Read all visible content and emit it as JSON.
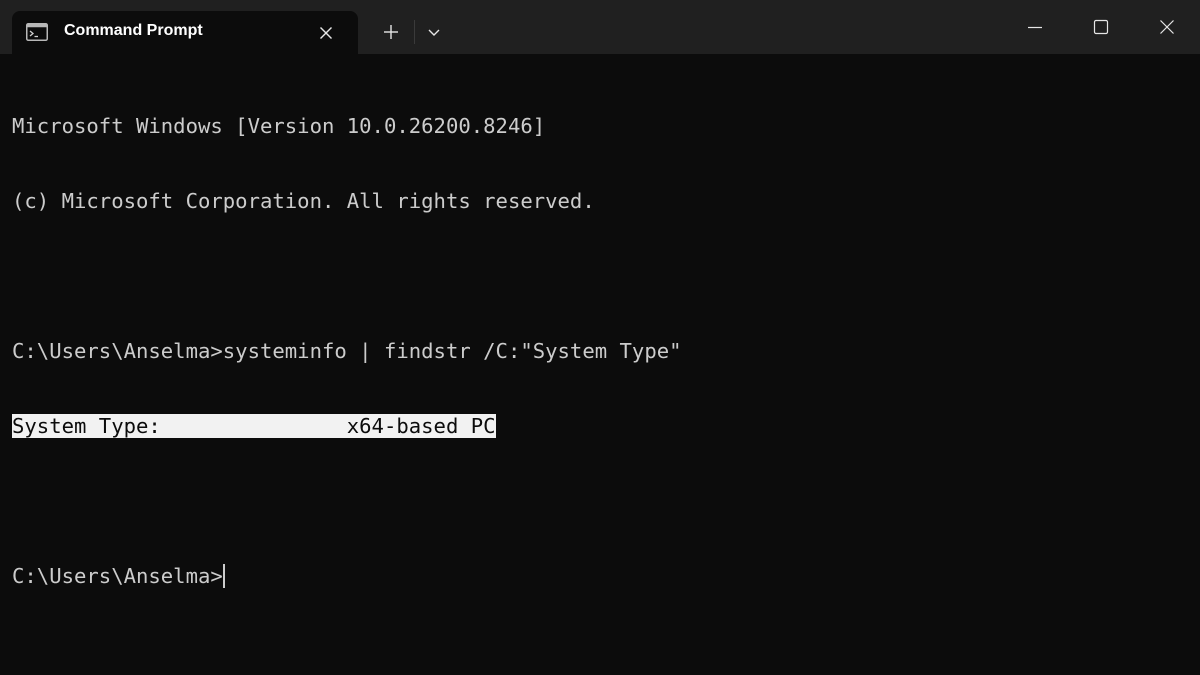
{
  "tab": {
    "title": "Command Prompt",
    "icon": "terminal-icon"
  },
  "tabbar": {
    "new_tab_icon": "plus-icon",
    "dropdown_icon": "chevron-down-icon"
  },
  "window_controls": {
    "minimize_icon": "minimize-icon",
    "maximize_icon": "maximize-icon",
    "close_icon": "close-icon"
  },
  "terminal": {
    "lines": [
      "Microsoft Windows [Version 10.0.26200.8246]",
      "(c) Microsoft Corporation. All rights reserved.",
      "",
      "C:\\Users\\Anselma>systeminfo | findstr /C:\"System Type\"",
      "System Type:               x64-based PC",
      "",
      "C:\\Users\\Anselma>"
    ],
    "highlighted_line_index": 4
  },
  "colors": {
    "background": "#0c0c0c",
    "titlebar": "#202020",
    "text": "#cccccc",
    "highlight_bg": "#f2f2f2"
  }
}
